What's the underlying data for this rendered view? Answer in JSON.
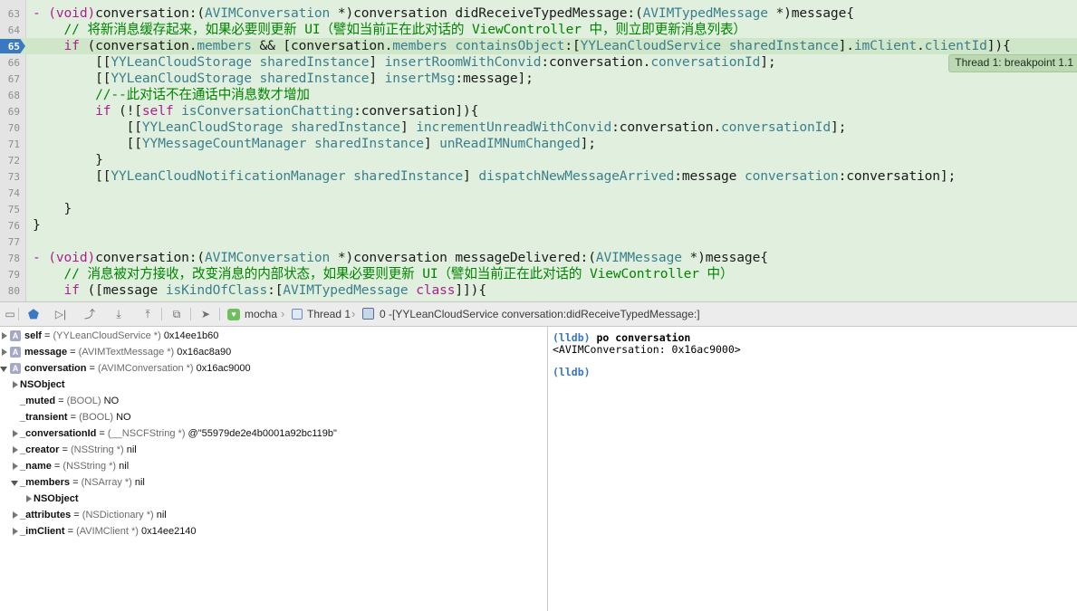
{
  "editor": {
    "lines": [
      {
        "n": "63",
        "html": "<span class=\"kw\">- (void)</span>conversation:(<span class=\"ty\">AVIMConversation</span> *)conversation didReceiveTypedMessage:(<span class=\"ty\">AVIMTypedMessage</span> *)message{"
      },
      {
        "n": "64",
        "html": "    <span class=\"cm\">// 将新消息缓存起来，如果必要则更新 UI（譬如当前正在此对话的 ViewController 中，则立即更新消息列表）</span>"
      },
      {
        "n": "65",
        "html": "    <span class=\"kw\">if</span> (conversation.<span class=\"pr\">members</span> && [conversation.<span class=\"pr\">members</span> <span class=\"pr\">containsObject</span>:[<span class=\"ty\">YYLeanCloudService</span> <span class=\"pr\">sharedInstance</span>].<span class=\"pr\">imClient</span>.<span class=\"pr\">clientId</span>]){"
      },
      {
        "n": "66",
        "html": "        [[<span class=\"ty\">YYLeanCloudStorage</span> <span class=\"pr\">sharedInstance</span>] <span class=\"pr\">insertRoomWithConvid</span>:conversation.<span class=\"pr\">conversationId</span>];"
      },
      {
        "n": "67",
        "html": "        [[<span class=\"ty\">YYLeanCloudStorage</span> <span class=\"pr\">sharedInstance</span>] <span class=\"pr\">insertMsg</span>:message];"
      },
      {
        "n": "68",
        "html": "        <span class=\"cm\">//--此对话不在通话中消息数才增加</span>"
      },
      {
        "n": "69",
        "html": "        <span class=\"kw\">if</span> (![<span class=\"kw\">self</span> <span class=\"pr\">isConversationChatting</span>:conversation]){"
      },
      {
        "n": "70",
        "html": "            [[<span class=\"ty\">YYLeanCloudStorage</span> <span class=\"pr\">sharedInstance</span>] <span class=\"pr\">incrementUnreadWithConvid</span>:conversation.<span class=\"pr\">conversationId</span>];"
      },
      {
        "n": "71",
        "html": "            [[<span class=\"ty\">YYMessageCountManager</span> <span class=\"pr\">sharedInstance</span>] <span class=\"pr\">unReadIMNumChanged</span>];"
      },
      {
        "n": "72",
        "html": "        }"
      },
      {
        "n": "73",
        "html": "        [[<span class=\"ty\">YYLeanCloudNotificationManager</span> <span class=\"pr\">sharedInstance</span>] <span class=\"pr\">dispatchNewMessageArrived</span>:message <span class=\"pr\">conversation</span>:conversation];"
      },
      {
        "n": "74",
        "html": ""
      },
      {
        "n": "75",
        "html": "    }"
      },
      {
        "n": "76",
        "html": "}"
      },
      {
        "n": "77",
        "html": ""
      },
      {
        "n": "78",
        "html": "<span class=\"kw\">- (void)</span>conversation:(<span class=\"ty\">AVIMConversation</span> *)conversation messageDelivered:(<span class=\"ty\">AVIMMessage</span> *)message{"
      },
      {
        "n": "79",
        "html": "    <span class=\"cm\">// 消息被对方接收，改变消息的内部状态，如果必要则更新 UI（譬如当前正在此对话的 ViewController 中）</span>"
      },
      {
        "n": "80",
        "html": "    <span class=\"kw\">if</span> ([message <span class=\"pr\">isKindOfClass</span>:[<span class=\"ty\">AVIMTypedMessage</span> <span class=\"kw\">class</span>]]){"
      }
    ],
    "current_line": "65",
    "breakpoint_badge": "Thread 1: breakpoint 1.1"
  },
  "toolbar": {
    "scheme": "mocha",
    "thread": "Thread 1",
    "frame": "0 -[YYLeanCloudService conversation:didReceiveTypedMessage:]"
  },
  "variables": [
    {
      "indent": 0,
      "tri": "closed",
      "icon": "A",
      "name": "self",
      "type": "(YYLeanCloudService *)",
      "value": "0x14ee1b60"
    },
    {
      "indent": 0,
      "tri": "closed",
      "icon": "A",
      "name": "message",
      "type": "(AVIMTextMessage *)",
      "value": "0x16ac8a90"
    },
    {
      "indent": 0,
      "tri": "open",
      "icon": "A",
      "name": "conversation",
      "type": "(AVIMConversation *)",
      "value": "0x16ac9000"
    },
    {
      "indent": 1,
      "tri": "closed",
      "icon": "",
      "name": "NSObject",
      "type": "",
      "value": ""
    },
    {
      "indent": 1,
      "tri": "",
      "icon": "",
      "name": "_muted",
      "type": "(BOOL)",
      "value": "NO"
    },
    {
      "indent": 1,
      "tri": "",
      "icon": "",
      "name": "_transient",
      "type": "(BOOL)",
      "value": "NO"
    },
    {
      "indent": 1,
      "tri": "closed",
      "icon": "",
      "name": "_conversationId",
      "type": "(__NSCFString *)",
      "value": "@\"55979de2e4b0001a92bc119b\""
    },
    {
      "indent": 1,
      "tri": "closed",
      "icon": "",
      "name": "_creator",
      "type": "(NSString *)",
      "value": "nil"
    },
    {
      "indent": 1,
      "tri": "closed",
      "icon": "",
      "name": "_name",
      "type": "(NSString *)",
      "value": "nil"
    },
    {
      "indent": 1,
      "tri": "open",
      "icon": "",
      "name": "_members",
      "type": "(NSArray *)",
      "value": "nil"
    },
    {
      "indent": 2,
      "tri": "closed",
      "icon": "",
      "name": "NSObject",
      "type": "",
      "value": ""
    },
    {
      "indent": 1,
      "tri": "closed",
      "icon": "",
      "name": "_attributes",
      "type": "(NSDictionary *)",
      "value": "nil"
    },
    {
      "indent": 1,
      "tri": "closed",
      "icon": "",
      "name": "_imClient",
      "type": "(AVIMClient *)",
      "value": "0x14ee2140"
    }
  ],
  "console": {
    "prompt": "(lldb)",
    "command": "po conversation",
    "output": "<AVIMConversation: 0x16ac9000>",
    "prompt2": "(lldb)"
  }
}
